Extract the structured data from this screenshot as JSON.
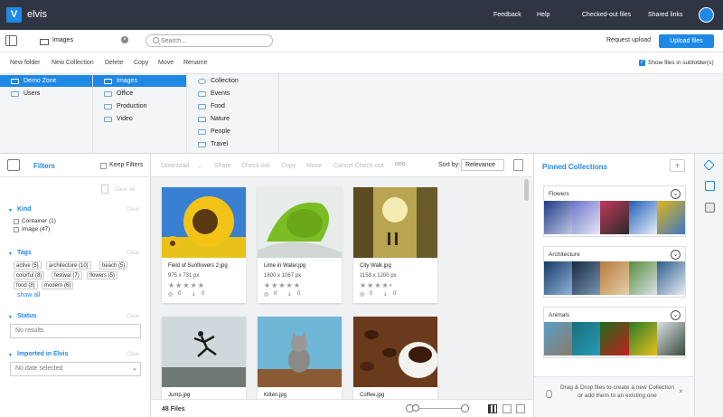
{
  "app": {
    "name": "elvis",
    "logo_letter": "V"
  },
  "topnav": [
    "Feedback",
    "Help",
    "Checked-out files",
    "Shared links"
  ],
  "location": {
    "title": "Images",
    "search_placeholder": "Search...",
    "request_upload": "Request upload",
    "upload_button": "Upload files"
  },
  "toolbar": {
    "items": [
      "New folder",
      "New Collection",
      "Delete",
      "Copy",
      "Move",
      "Rename"
    ],
    "show_subfolders": "Show files in subfolder(s)"
  },
  "browser": {
    "col1": [
      {
        "label": "Demo Zone",
        "selected": true
      },
      {
        "label": "Users"
      }
    ],
    "col2": [
      {
        "label": "Images",
        "selected": true
      },
      {
        "label": "Office"
      },
      {
        "label": "Production"
      },
      {
        "label": "Video"
      }
    ],
    "col3": [
      {
        "label": "Collection"
      },
      {
        "label": "Events"
      },
      {
        "label": "Food"
      },
      {
        "label": "Nature"
      },
      {
        "label": "People"
      },
      {
        "label": "Travel"
      }
    ]
  },
  "filters": {
    "title": "Filters",
    "keep_filters": "Keep Filters",
    "clear_all": "Clear all",
    "kind": {
      "title": "Kind",
      "clear": "Clear",
      "options": [
        "Container (1)",
        "Image (47)"
      ]
    },
    "tags": {
      "title": "Tags",
      "clear": "Clear",
      "items": [
        "active (5)",
        "architecture (10)",
        "beach (5)",
        "colorful (8)",
        "festival (7)",
        "flowers (5)",
        "food (8)",
        "modern (6)"
      ],
      "show_all": "show all"
    },
    "status": {
      "title": "Status",
      "clear": "Clear",
      "value": "No results"
    },
    "imported": {
      "title": "Imported in Elvis",
      "clear": "Clear",
      "value": "No date selected"
    }
  },
  "actions": [
    "Download",
    "Share",
    "Check out",
    "Copy",
    "Move",
    "Cancel Check-out"
  ],
  "more_icon": "ooo",
  "sort": {
    "label": "Sort by:",
    "value": "Relevance"
  },
  "files": [
    {
      "name": "Field of Sunflowers 2.jpg",
      "size": "975 x 731 px",
      "views": "0",
      "downloads": "0"
    },
    {
      "name": "Lime in Water.jpg",
      "size": "1600 x 1067 px",
      "views": "0",
      "downloads": "0"
    },
    {
      "name": "City Walk.jpg",
      "size": "1158 x 1200 px",
      "views": "0",
      "downloads": "0"
    },
    {
      "name": "Jump.jpg"
    },
    {
      "name": "Kitten.jpg"
    },
    {
      "name": "Coffee.jpg"
    }
  ],
  "file_count": "48 Files",
  "pinned": {
    "title": "Pinned Collections",
    "add": "+",
    "collections": [
      {
        "name": "Flowers"
      },
      {
        "name": "Architecture"
      },
      {
        "name": "Animals"
      }
    ],
    "dnd_text": "Drag & Drop files to create a new Collection or add them to an existing one",
    "close": "×"
  },
  "colors": {
    "accent": "#1e88e5",
    "topbar": "#2f3542"
  }
}
